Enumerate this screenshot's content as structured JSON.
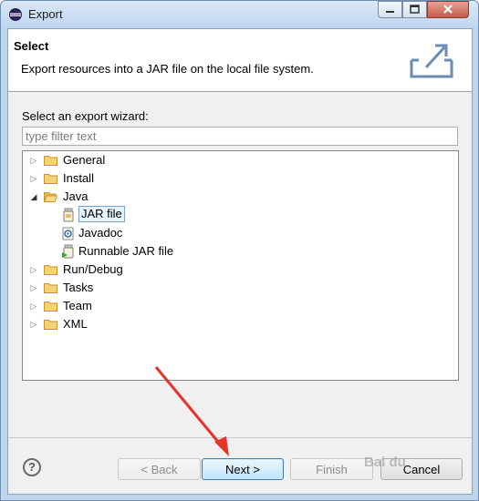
{
  "window": {
    "title": "Export"
  },
  "header": {
    "title": "Select",
    "description": "Export resources into a JAR file on the local file system."
  },
  "wizard": {
    "label": "Select an export wizard:",
    "filter_placeholder": "type filter text",
    "tree": [
      {
        "label": "General",
        "icon": "folder-icon",
        "expanded": false
      },
      {
        "label": "Install",
        "icon": "folder-icon",
        "expanded": false
      },
      {
        "label": "Java",
        "icon": "folder-open-icon",
        "expanded": true
      },
      {
        "label": "JAR file",
        "icon": "jar-icon",
        "selected": true
      },
      {
        "label": "Javadoc",
        "icon": "javadoc-icon"
      },
      {
        "label": "Runnable JAR file",
        "icon": "runnable-jar-icon"
      },
      {
        "label": "Run/Debug",
        "icon": "folder-icon",
        "expanded": false
      },
      {
        "label": "Tasks",
        "icon": "folder-icon",
        "expanded": false
      },
      {
        "label": "Team",
        "icon": "folder-icon",
        "expanded": false
      },
      {
        "label": "XML",
        "icon": "folder-icon",
        "expanded": false
      }
    ]
  },
  "buttons": {
    "help": "?",
    "back": "< Back",
    "next": "Next >",
    "finish": "Finish",
    "cancel": "Cancel"
  },
  "colors": {
    "arrow": "#e8332b",
    "selection": "#e5f3fb",
    "folder": "#e8b84a"
  },
  "watermark": "Bai du"
}
